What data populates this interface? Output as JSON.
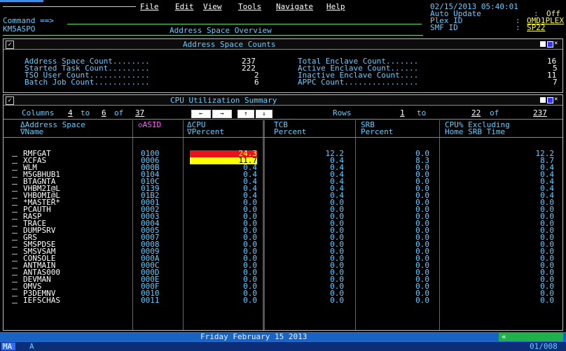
{
  "menu": {
    "items": [
      "File",
      "Edit",
      "View",
      "Tools",
      "Navigate",
      "Help"
    ],
    "datetime": "02/15/2013 05:40:01",
    "auto_update_label": "Auto Update",
    "auto_update_value": "Off",
    "plex_label": "Plex ID",
    "plex_value": "OMD1PLEX",
    "smf_label": "SMF ID",
    "smf_value": "SP22"
  },
  "command": {
    "label": "Command ==>",
    "screen_id": "KM5ASPO",
    "title": "Address Space Overview"
  },
  "counts_panel": {
    "title": "Address Space Counts",
    "left": [
      {
        "label": "Address Space Count........",
        "value": "237"
      },
      {
        "label": "Started Task Count.........",
        "value": "222"
      },
      {
        "label": "TSO User Count.............",
        "value": "2"
      },
      {
        "label": "Batch Job Count............",
        "value": "6"
      }
    ],
    "right": [
      {
        "label": "Total Enclave Count.......",
        "value": "16"
      },
      {
        "label": "Active Enclave Count......",
        "value": "5"
      },
      {
        "label": "Inactive Enclave Count....",
        "value": "11"
      },
      {
        "label": "APPC Count................",
        "value": "7"
      }
    ]
  },
  "cpu_panel": {
    "title": "CPU Utilization Summary",
    "columns_label": "Columns",
    "col_from": "4",
    "col_to_label": "to",
    "col_to": "6",
    "col_of_label": "of",
    "col_total": "37",
    "rows_label": "Rows",
    "row_from": "1",
    "row_to_label": "to",
    "row_to": "22",
    "row_of_label": "of",
    "row_total": "237",
    "nav": {
      "left": "←",
      "right": "→",
      "up": "↑",
      "down": "↓"
    },
    "headers": {
      "name1": "ΔAddress Space",
      "name2": "∇Name",
      "asid": "◇ASID",
      "cpu1": "ΔCPU",
      "cpu2": "∇Percent",
      "tcb1": "TCB",
      "tcb2": "Percent",
      "srb1": "SRB",
      "srb2": "Percent",
      "ex1": "CPU% Excluding",
      "ex2": "Home SRB Time"
    },
    "rows": [
      {
        "name": "RMFGAT",
        "asid": "0100",
        "cpu": "24.3",
        "tcb": "12.2",
        "srb": "0.0",
        "ex": "12.2"
      },
      {
        "name": "XCFAS",
        "asid": "0006",
        "cpu": "11.7",
        "tcb": "0.4",
        "srb": "8.3",
        "ex": "8.7"
      },
      {
        "name": "WLM",
        "asid": "000B",
        "cpu": "0.4",
        "tcb": "0.4",
        "srb": "0.0",
        "ex": "0.4"
      },
      {
        "name": "M5GBHUB1",
        "asid": "0104",
        "cpu": "0.4",
        "tcb": "0.4",
        "srb": "0.0",
        "ex": "0.4"
      },
      {
        "name": "BTAGNTA",
        "asid": "010C",
        "cpu": "0.4",
        "tcb": "0.4",
        "srb": "0.0",
        "ex": "0.4"
      },
      {
        "name": "VHBM2I@L",
        "asid": "0139",
        "cpu": "0.4",
        "tcb": "0.4",
        "srb": "0.0",
        "ex": "0.4"
      },
      {
        "name": "VHBOMI@L",
        "asid": "01B2",
        "cpu": "0.4",
        "tcb": "0.4",
        "srb": "0.0",
        "ex": "0.4"
      },
      {
        "name": "*MASTER*",
        "asid": "0001",
        "cpu": "0.0",
        "tcb": "0.0",
        "srb": "0.0",
        "ex": "0.0"
      },
      {
        "name": "PCAUTH",
        "asid": "0002",
        "cpu": "0.0",
        "tcb": "0.0",
        "srb": "0.0",
        "ex": "0.0"
      },
      {
        "name": "RASP",
        "asid": "0003",
        "cpu": "0.0",
        "tcb": "0.0",
        "srb": "0.0",
        "ex": "0.0"
      },
      {
        "name": "TRACE",
        "asid": "0004",
        "cpu": "0.0",
        "tcb": "0.0",
        "srb": "0.0",
        "ex": "0.0"
      },
      {
        "name": "DUMPSRV",
        "asid": "0005",
        "cpu": "0.0",
        "tcb": "0.0",
        "srb": "0.0",
        "ex": "0.0"
      },
      {
        "name": "GRS",
        "asid": "0007",
        "cpu": "0.0",
        "tcb": "0.0",
        "srb": "0.0",
        "ex": "0.0"
      },
      {
        "name": "SMSPDSE",
        "asid": "0008",
        "cpu": "0.0",
        "tcb": "0.0",
        "srb": "0.0",
        "ex": "0.0"
      },
      {
        "name": "SMSVSAM",
        "asid": "0009",
        "cpu": "0.0",
        "tcb": "0.0",
        "srb": "0.0",
        "ex": "0.0"
      },
      {
        "name": "CONSOLE",
        "asid": "000A",
        "cpu": "0.0",
        "tcb": "0.0",
        "srb": "0.0",
        "ex": "0.0"
      },
      {
        "name": "ANTMAIN",
        "asid": "000C",
        "cpu": "0.0",
        "tcb": "0.0",
        "srb": "0.0",
        "ex": "0.0"
      },
      {
        "name": "ANTAS000",
        "asid": "000D",
        "cpu": "0.0",
        "tcb": "0.0",
        "srb": "0.0",
        "ex": "0.0"
      },
      {
        "name": "DEVMAN",
        "asid": "000E",
        "cpu": "0.0",
        "tcb": "0.0",
        "srb": "0.0",
        "ex": "0.0"
      },
      {
        "name": "OMVS",
        "asid": "000F",
        "cpu": "0.0",
        "tcb": "0.0",
        "srb": "0.0",
        "ex": "0.0"
      },
      {
        "name": "P3DEMNV",
        "asid": "0010",
        "cpu": "0.0",
        "tcb": "0.0",
        "srb": "0.0",
        "ex": "0.0"
      },
      {
        "name": "IEFSCHAS",
        "asid": "0011",
        "cpu": "0.0",
        "tcb": "0.0",
        "srb": "0.0",
        "ex": "0.0"
      }
    ]
  },
  "footer": {
    "date_text": "Friday February 15 2013",
    "scroll_glyph": "«",
    "status_left": "MA",
    "status_mode": "A",
    "status_right": "01/008"
  },
  "colors": {
    "red_highlight": "#e8141b",
    "yellow_highlight": "#ffff00",
    "panel_bg": "#000000",
    "footer_bar": "#1f73d6",
    "status_bar": "#0c2d78"
  }
}
